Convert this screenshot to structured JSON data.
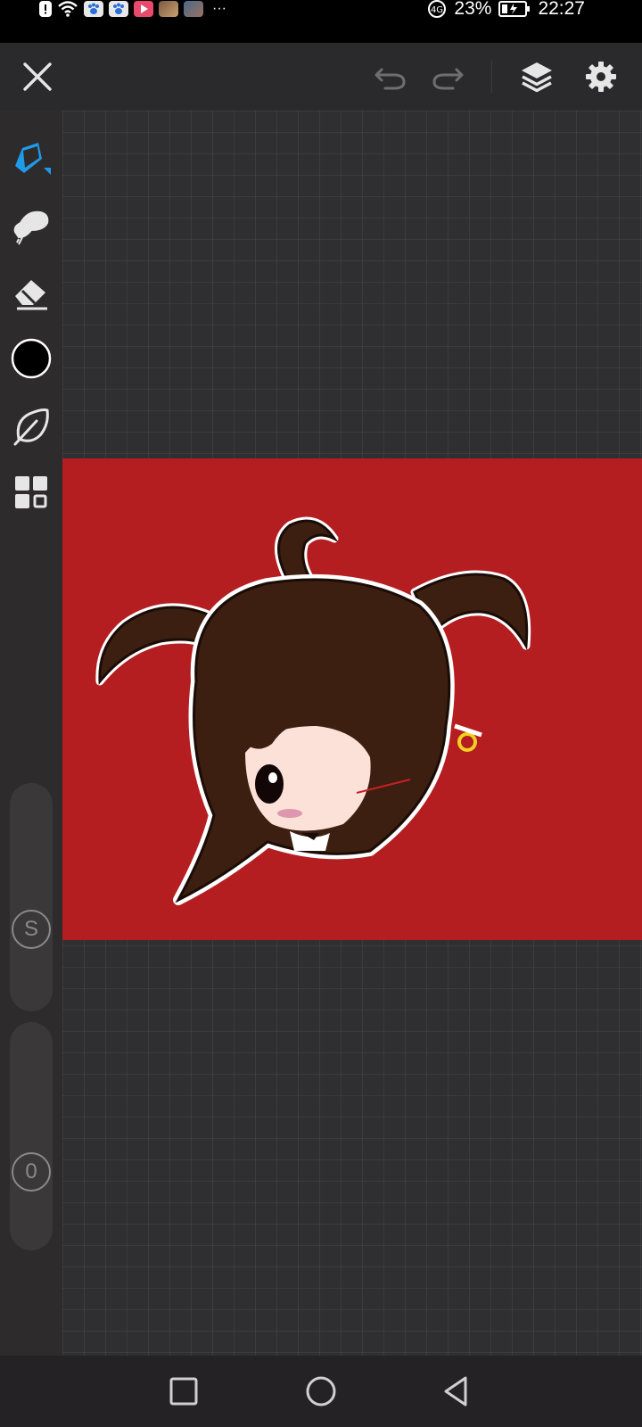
{
  "status_bar": {
    "battery_percent": "23%",
    "time": "22:27",
    "overflow": "···"
  },
  "toolbar": {
    "close": "close-icon",
    "undo": "undo-icon",
    "redo": "redo-icon",
    "layers": "layers-icon",
    "settings": "gear-icon"
  },
  "tools": {
    "brush": "pen-tip-icon",
    "smudge": "smudge-icon",
    "eraser": "eraser-icon",
    "color": "#000000",
    "lasso": "leaf-icon",
    "gallery": "grid-icon"
  },
  "sliders": {
    "size_label": "S",
    "opacity_label": "0"
  },
  "colors": {
    "accent": "#1e9be8",
    "artboard_bg": "#b51e21",
    "hair": "#3c1f10",
    "skin": "#fbe1d8"
  }
}
